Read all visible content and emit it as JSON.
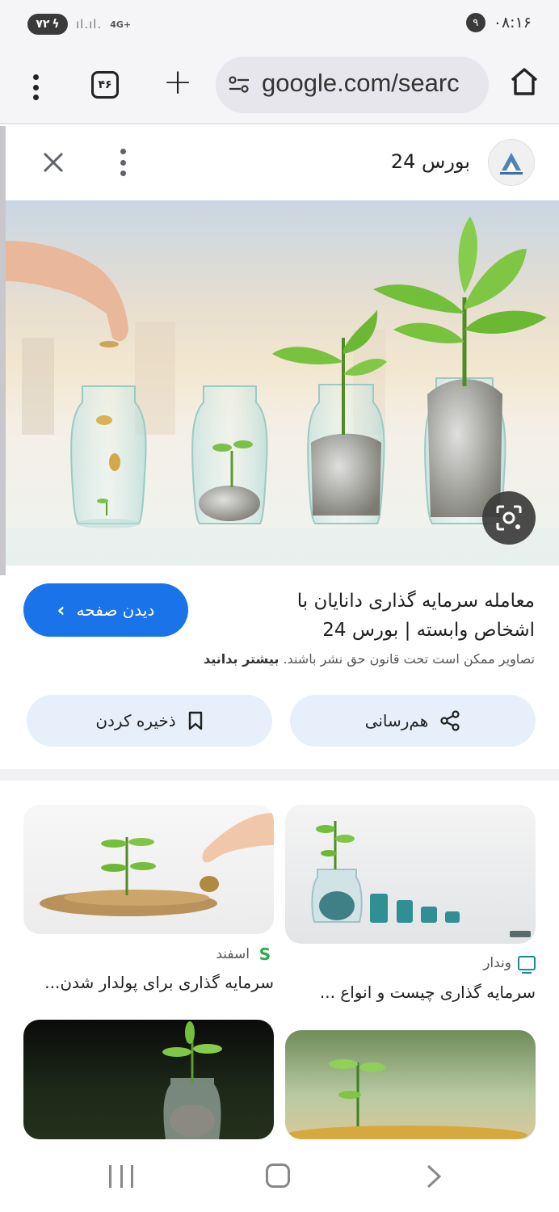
{
  "status_bar": {
    "battery": "۷۲",
    "network": "4G+",
    "notifications": "۹",
    "time": "۰۸:۱۶"
  },
  "browser": {
    "tab_count": "۴۶",
    "url": "google.com/searc"
  },
  "panel": {
    "site_name": "بورس 24",
    "result_title": "معامله سرمایه گذاری دانایان با اشخاص وابسته | بورس 24",
    "copyright_text": "تصاویر ممکن است تحت قانون حق نشر باشند.",
    "learn_more": "بیشتر بدانید",
    "visit_label": "دیدن صفحه",
    "share_label": "هم‌رسانی",
    "save_label": "ذخیره کردن"
  },
  "related": [
    {
      "source": "وندار",
      "caption": "سرمایه گذاری چیست و انواع ..."
    },
    {
      "source": "اسفند",
      "caption": "سرمایه گذاری برای پولدار شدن..."
    }
  ],
  "icons": {
    "lens": "google-lens-icon",
    "home": "home-icon",
    "close": "close-icon"
  },
  "colors": {
    "accent": "#1a73e8",
    "pill_bg": "#e6effa",
    "toolbar_bg": "#f5f5f7"
  }
}
